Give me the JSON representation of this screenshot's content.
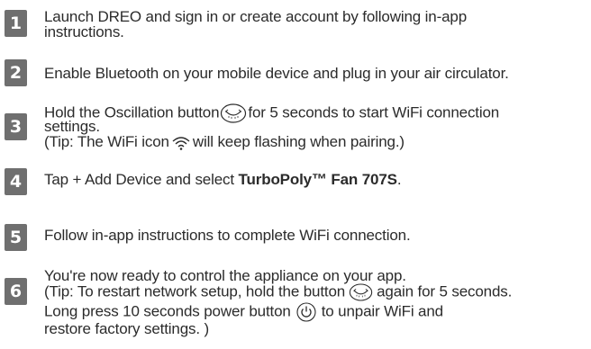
{
  "steps": [
    {
      "number": "1",
      "lines": [
        "Launch DREO and sign in or create account by following in-app",
        "instructions."
      ]
    },
    {
      "number": "2",
      "lines": [
        "Enable Bluetooth on your mobile device and plug in your air circulator."
      ]
    },
    {
      "number": "3",
      "line1a": "Hold the Oscillation button",
      "line1b": "for 5 seconds to start WiFi connection",
      "line2": "settings.",
      "line3a": "(Tip: The WiFi icon",
      "line3b": "will keep flashing when pairing.)"
    },
    {
      "number": "4",
      "text_a": "Tap + Add Device and select ",
      "text_bold": "TurboPoly™ Fan 707S",
      "text_c": "."
    },
    {
      "number": "5",
      "text": "Follow in-app instructions to complete WiFi connection."
    },
    {
      "number": "6",
      "line1": "You're now ready to control the appliance on your app.",
      "line2a": "(Tip: To restart network setup, hold the button",
      "line2b": "again for 5 seconds.",
      "line3a": "Long press 10 seconds power button",
      "line3b": "to unpair WiFi and",
      "line4": "restore factory settings. )"
    }
  ],
  "icons": {
    "oscillation": "oscillation-icon",
    "wifi": "wifi-icon",
    "power": "power-icon"
  },
  "colors": {
    "badge": "#6f6f6f",
    "text": "#2b2b2b"
  }
}
